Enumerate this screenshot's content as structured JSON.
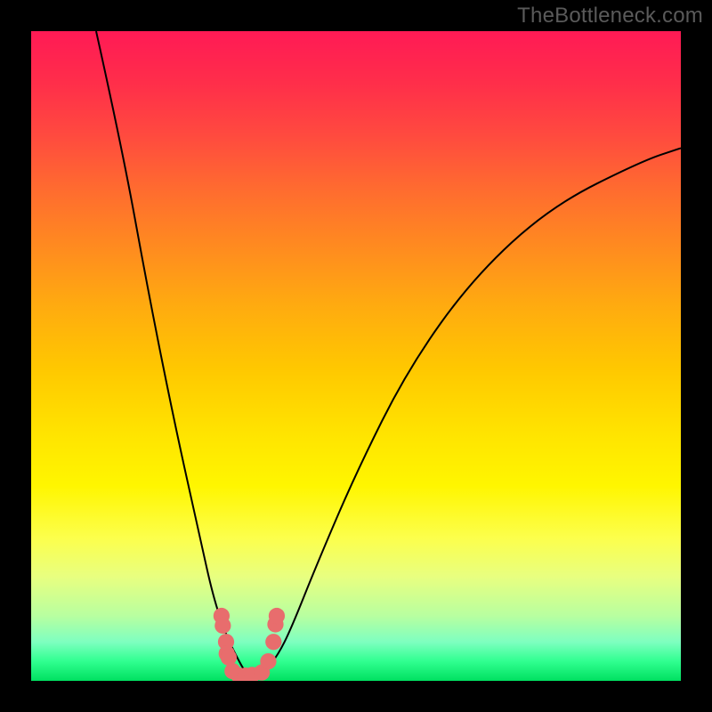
{
  "watermark": "TheBottleneck.com",
  "chart_data": {
    "type": "line",
    "title": "",
    "xlabel": "",
    "ylabel": "",
    "xlim": [
      0,
      100
    ],
    "ylim": [
      0,
      100
    ],
    "grid": false,
    "legend": false,
    "note": "V-shaped bottleneck curve over a vertical red→orange→yellow→green gradient. Pink dotted markers cluster near the valley. No axis ticks or labels are visible in the source image; x/y values are estimated in viewBox units (0–100).",
    "series": [
      {
        "name": "bottleneck-curve-left",
        "x": [
          10,
          14,
          18,
          22,
          26,
          28,
          30,
          32,
          33,
          34
        ],
        "values": [
          100,
          82,
          60,
          40,
          22,
          13,
          7,
          3,
          1.3,
          0.8
        ]
      },
      {
        "name": "bottleneck-curve-right",
        "x": [
          34,
          36,
          38,
          40,
          44,
          50,
          58,
          68,
          80,
          94,
          100
        ],
        "values": [
          0.8,
          1.5,
          4,
          8,
          18,
          32,
          48,
          62,
          73,
          80,
          82
        ]
      },
      {
        "name": "valley-markers",
        "marker": "dot",
        "color": "#e86d6d",
        "x": [
          29.3,
          29.5,
          30,
          30.1,
          30.4,
          31,
          32,
          33,
          34,
          35.5,
          36.5,
          37.3,
          37.6,
          37.8
        ],
        "values": [
          10,
          8.5,
          6,
          4.2,
          3.6,
          1.5,
          0.8,
          0.8,
          0.9,
          1.3,
          3,
          6,
          8.7,
          10
        ]
      }
    ]
  }
}
